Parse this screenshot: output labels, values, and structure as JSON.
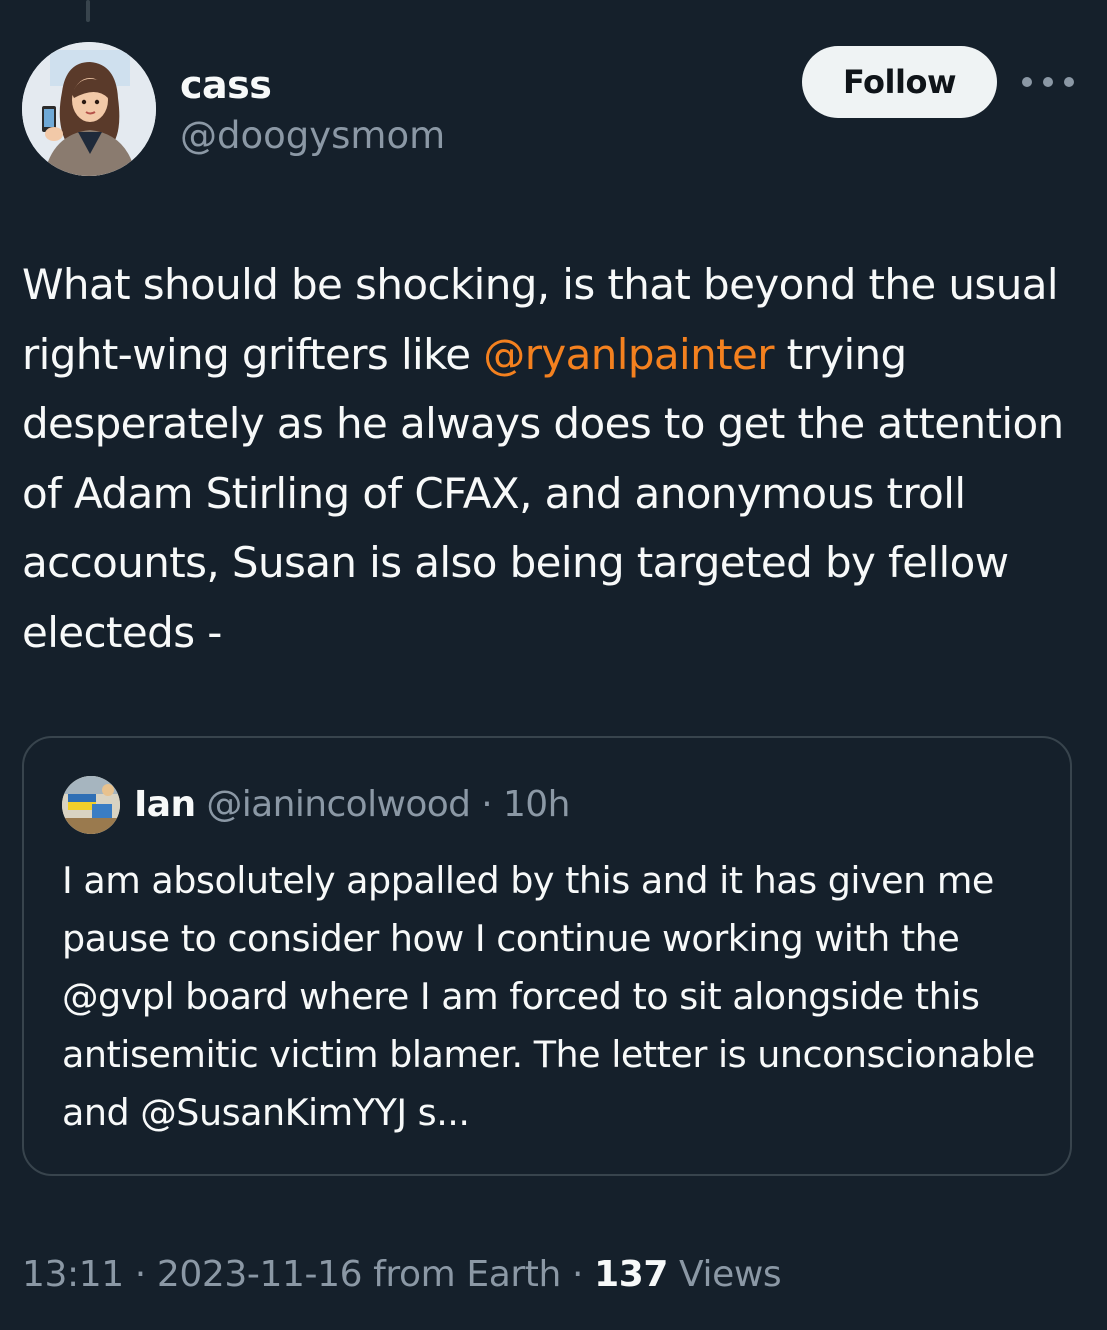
{
  "author": {
    "display_name": "cass",
    "handle": "@doogysmom"
  },
  "actions": {
    "follow_label": "Follow",
    "more_icon": "more-horizontal-icon"
  },
  "tweet": {
    "text_before": "What should be shocking, is that beyond the usual right-wing grifters like ",
    "mention": "@ryanlpainter",
    "text_after": " trying desperately as he always does to get the attention of Adam Stirling of CFAX, and anonymous troll accounts, Susan is also being targeted by fellow electeds -"
  },
  "quoted_tweet": {
    "display_name": "Ian",
    "handle": "@ianincolwood",
    "separator": " · ",
    "time": "10h",
    "text": "I am absolutely appalled by this and it has given me pause to consider how I continue working with the @gvpl board where I am forced to sit alongside this antisemitic victim blamer. The letter is unconscionable and @SusanKimYYJ s..."
  },
  "meta": {
    "time": "13:11",
    "separator": " · ",
    "date_source": "2023-11-16 from Earth",
    "views_count": "137",
    "views_label": " Views"
  },
  "colors": {
    "background": "#15202b",
    "text_primary": "#f7f9f9",
    "text_secondary": "#8b98a5",
    "mention": "#f4811f",
    "border": "#38444d",
    "follow_bg": "#eff3f4"
  }
}
